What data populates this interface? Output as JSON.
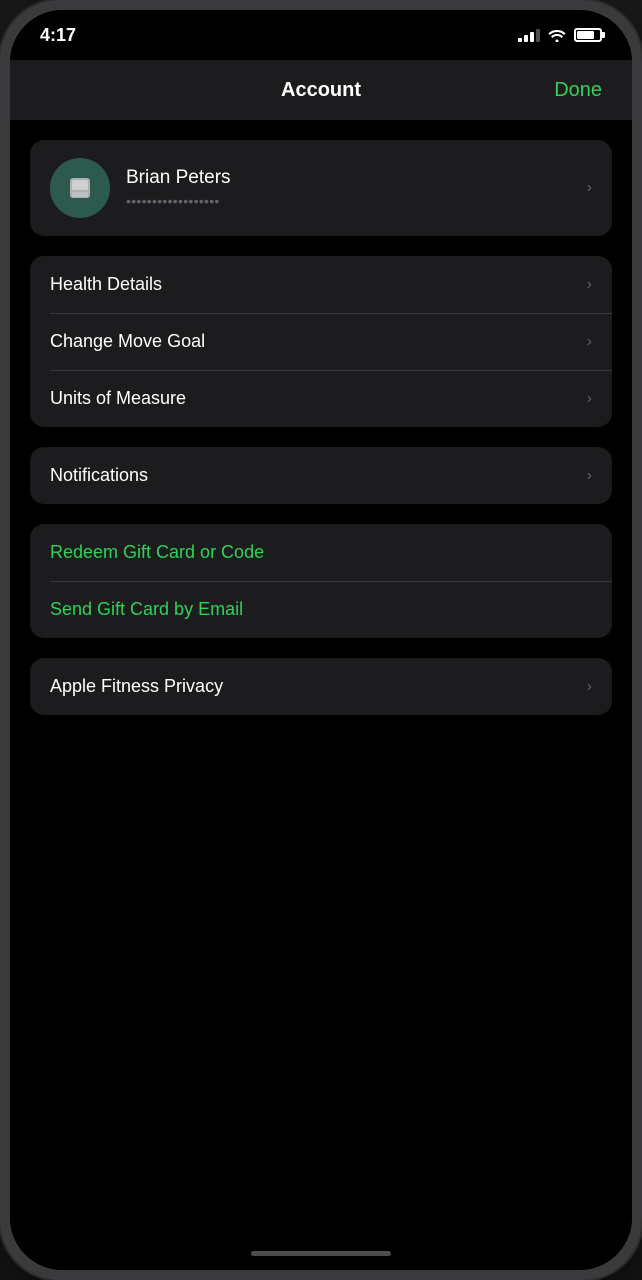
{
  "status_bar": {
    "time": "4:17"
  },
  "nav": {
    "title": "Account",
    "done_label": "Done"
  },
  "profile": {
    "name": "Brian Peters",
    "email": "••••••••••••••••••"
  },
  "menu_sections": [
    {
      "id": "settings",
      "items": [
        {
          "id": "health-details",
          "label": "Health Details",
          "green": false
        },
        {
          "id": "change-move-goal",
          "label": "Change Move Goal",
          "green": false
        },
        {
          "id": "units-of-measure",
          "label": "Units of Measure",
          "green": false
        }
      ]
    },
    {
      "id": "notifications",
      "items": [
        {
          "id": "notifications",
          "label": "Notifications",
          "green": false
        }
      ]
    },
    {
      "id": "gift",
      "items": [
        {
          "id": "redeem-gift-card",
          "label": "Redeem Gift Card or Code",
          "green": true
        },
        {
          "id": "send-gift-card",
          "label": "Send Gift Card by Email",
          "green": true
        }
      ]
    },
    {
      "id": "privacy",
      "items": [
        {
          "id": "apple-fitness-privacy",
          "label": "Apple Fitness Privacy",
          "green": false
        }
      ]
    }
  ]
}
